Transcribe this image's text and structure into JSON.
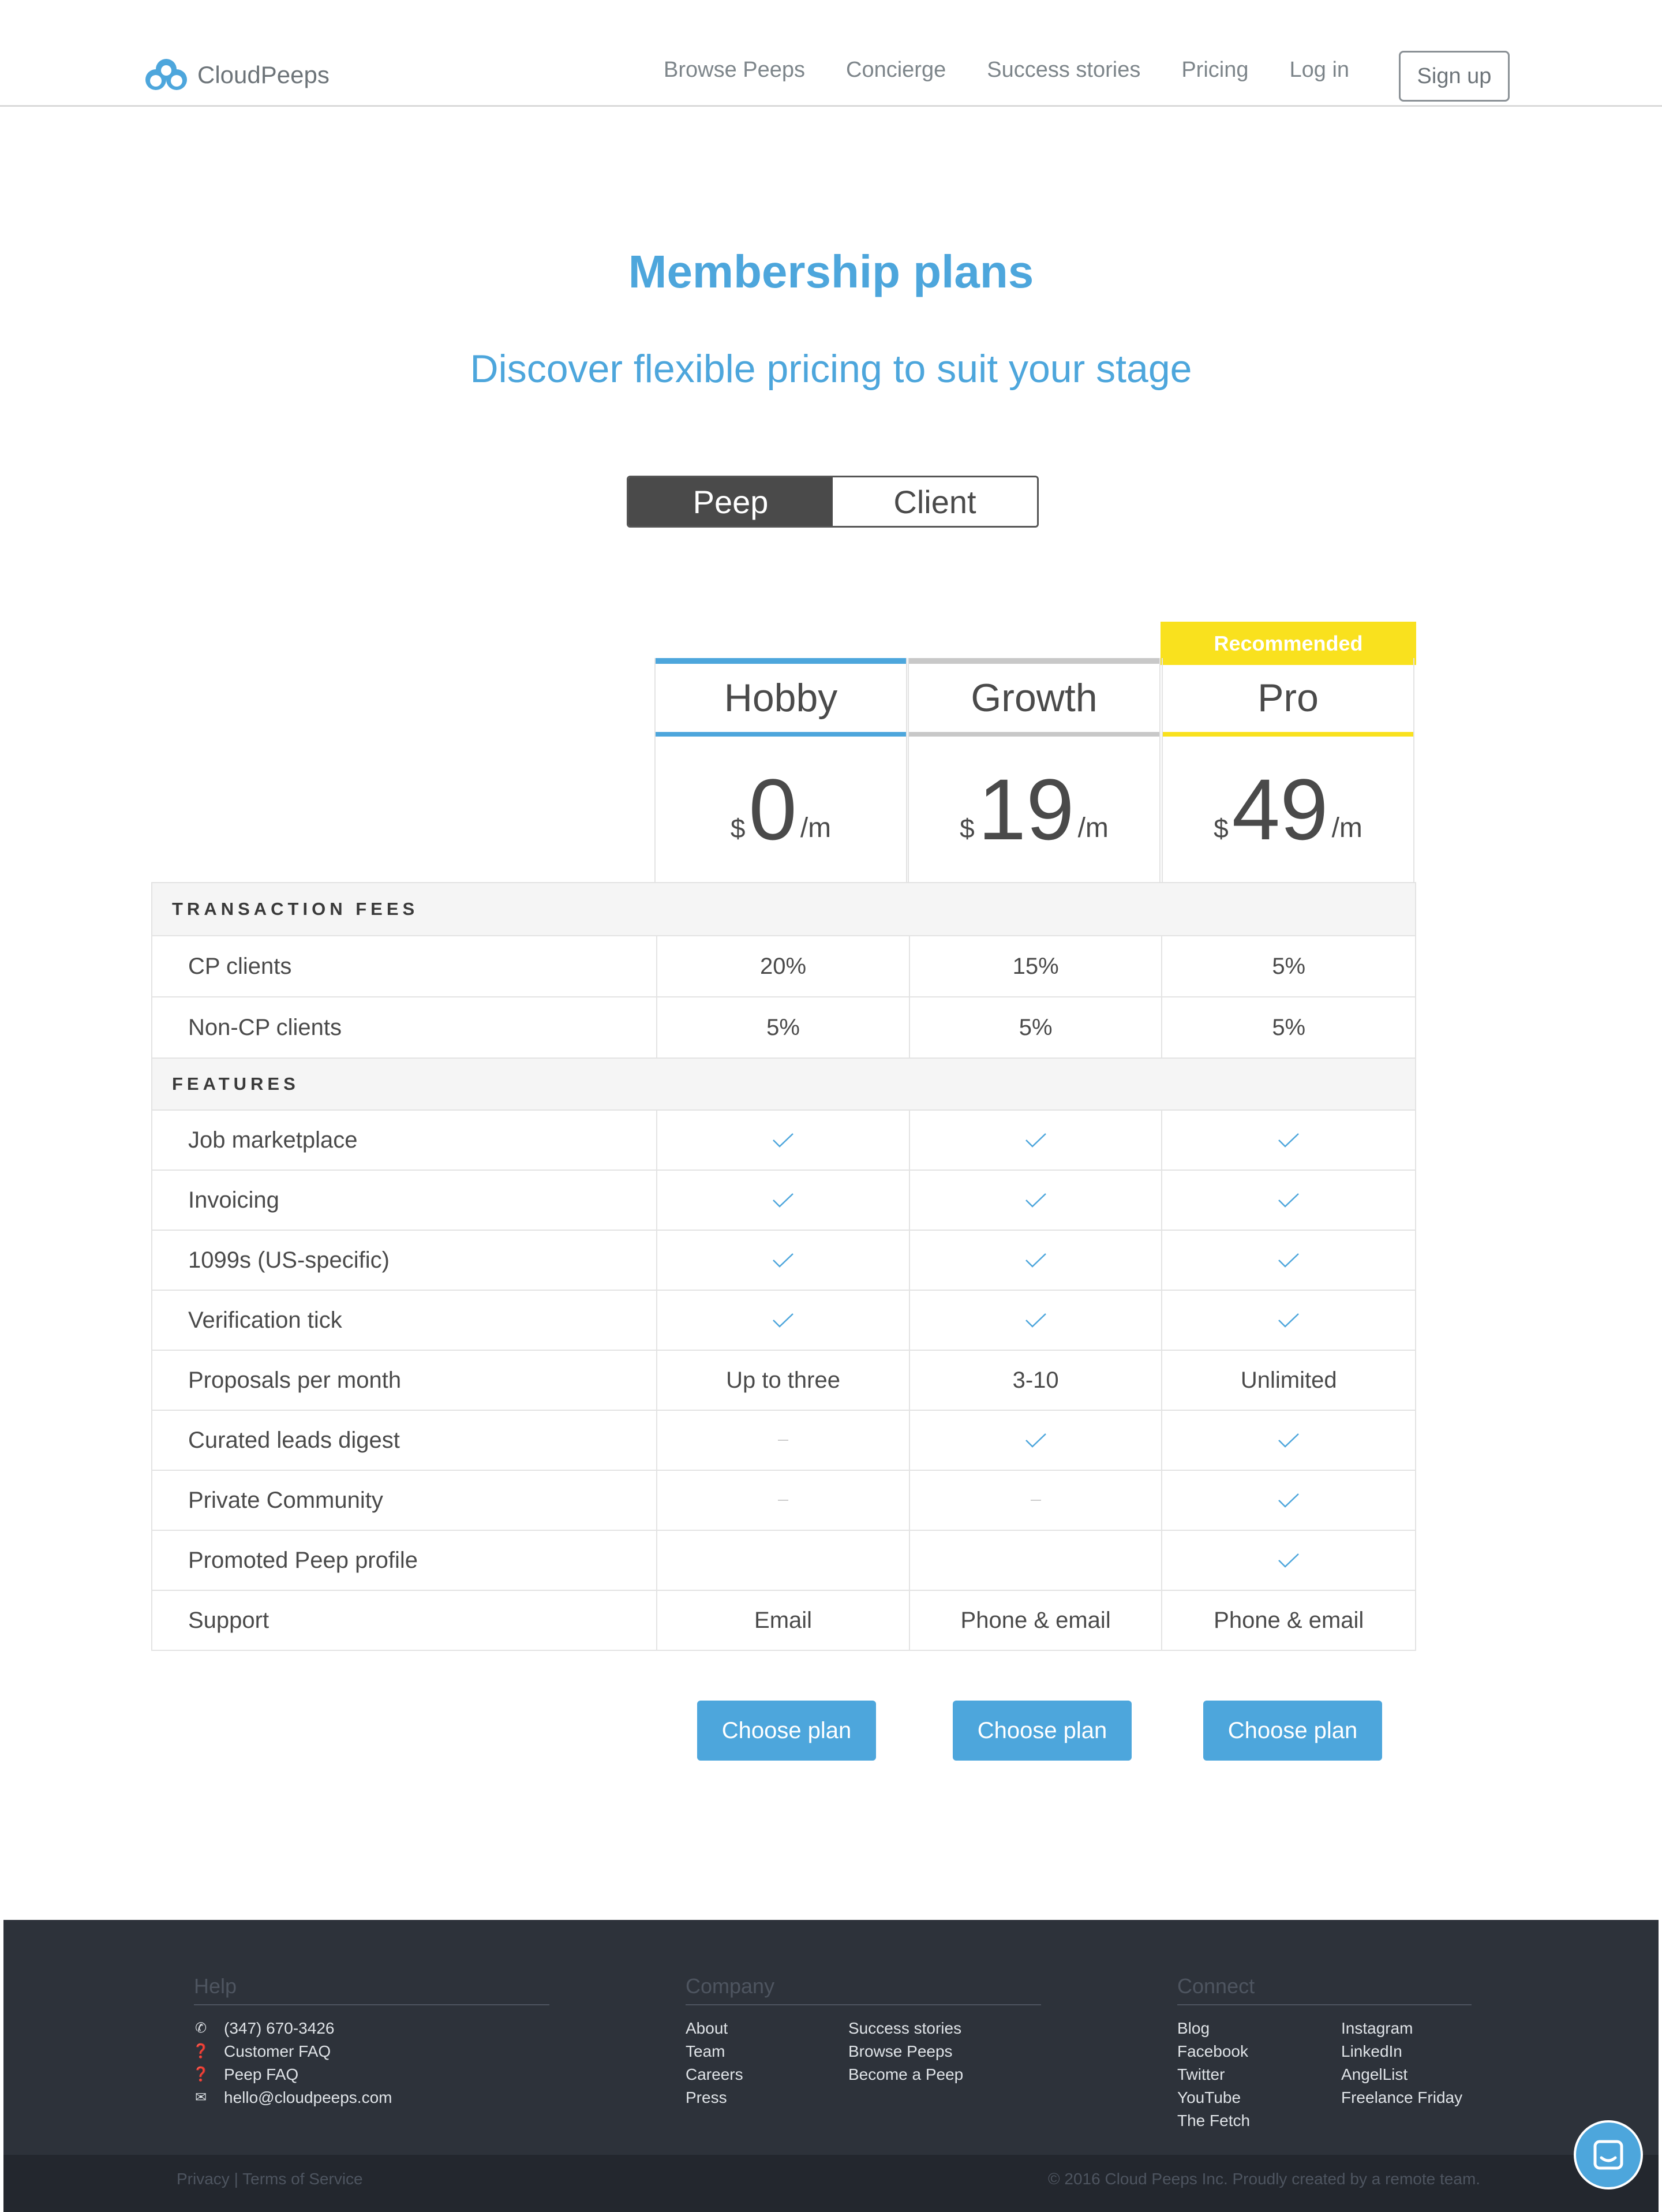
{
  "header": {
    "logo_text": "CloudPeeps",
    "nav": [
      "Browse Peeps",
      "Concierge",
      "Success stories",
      "Pricing",
      "Log in"
    ],
    "signup_label": "Sign up"
  },
  "hero": {
    "title": "Membership plans",
    "subtitle": "Discover flexible pricing to suit your stage"
  },
  "toggle": {
    "active": "Peep",
    "inactive": "Client"
  },
  "plans": [
    {
      "name": "Hobby",
      "currency": "$",
      "amount": "0",
      "period": "/m",
      "color": "#4da6dc"
    },
    {
      "name": "Growth",
      "currency": "$",
      "amount": "19",
      "period": "/m",
      "color": "#c8c8c8"
    },
    {
      "name": "Pro",
      "currency": "$",
      "amount": "49",
      "period": "/m",
      "color": "#f9e11e"
    }
  ],
  "recommended_label": "Recommended",
  "sections": [
    {
      "title": "TRANSACTION FEES",
      "rows": [
        {
          "label": "CP clients",
          "values": [
            "20%",
            "15%",
            "5%"
          ]
        },
        {
          "label": "Non-CP clients",
          "values": [
            "5%",
            "5%",
            "5%"
          ]
        }
      ]
    },
    {
      "title": "FEATURES",
      "rows": [
        {
          "label": "Job marketplace",
          "values": [
            "check",
            "check",
            "check"
          ]
        },
        {
          "label": "Invoicing",
          "values": [
            "check",
            "check",
            "check"
          ]
        },
        {
          "label": "1099s (US-specific)",
          "values": [
            "check",
            "check",
            "check"
          ]
        },
        {
          "label": "Verification tick",
          "values": [
            "check",
            "check",
            "check"
          ]
        },
        {
          "label": "Proposals per month",
          "values": [
            "Up to three",
            "3-10",
            "Unlimited"
          ]
        },
        {
          "label": "Curated leads digest",
          "values": [
            "dash",
            "check",
            "check"
          ]
        },
        {
          "label": "Private Community",
          "values": [
            "dash",
            "dash",
            "check"
          ]
        },
        {
          "label": "Promoted Peep profile",
          "values": [
            "",
            "",
            "check"
          ]
        },
        {
          "label": "Support",
          "values": [
            "Email",
            "Phone & email",
            "Phone & email"
          ]
        }
      ]
    }
  ],
  "choose_label": "Choose plan",
  "footer": {
    "help": {
      "title": "Help",
      "items": [
        {
          "icon": "phone-icon",
          "label": "(347) 670-3426"
        },
        {
          "icon": "question-icon",
          "label": "Customer FAQ"
        },
        {
          "icon": "question-icon",
          "label": "Peep FAQ"
        },
        {
          "icon": "mail-icon",
          "label": "hello@cloudpeeps.com"
        }
      ]
    },
    "company": {
      "title": "Company",
      "col1": [
        "About",
        "Team",
        "Careers",
        "Press"
      ],
      "col2": [
        "Success stories",
        "Browse Peeps",
        "Become a Peep"
      ]
    },
    "connect": {
      "title": "Connect",
      "col1": [
        "Blog",
        "Facebook",
        "Twitter",
        "YouTube",
        "The Fetch"
      ],
      "col2": [
        "Instagram",
        "LinkedIn",
        "AngelList",
        "Freelance Friday"
      ]
    },
    "legal_left": "Privacy | Terms of Service",
    "legal_right": "© 2016 Cloud Peeps Inc. Proudly created by a remote team."
  },
  "colors": {
    "accent": "#4da6dc",
    "recommended": "#f9e11e",
    "footer_bg": "#2d323a"
  }
}
